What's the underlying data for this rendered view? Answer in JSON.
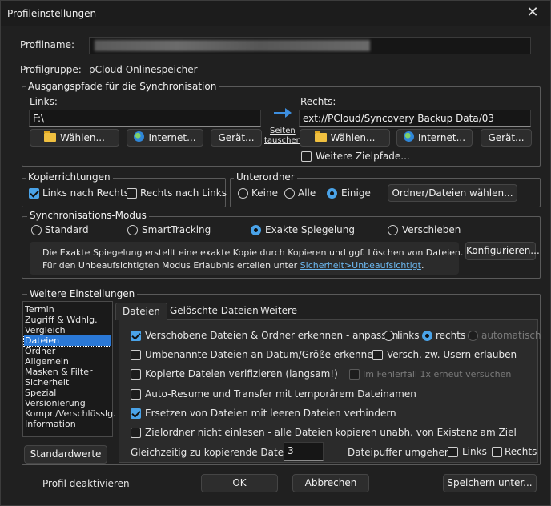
{
  "window": {
    "title": "Profileinstellungen",
    "close": "✕"
  },
  "profile": {
    "name_label": "Profilname:",
    "group_label": "Profilgruppe:",
    "group_value": "pCloud Onlinespeicher"
  },
  "paths": {
    "title": "Ausgangspfade für die Synchronisation",
    "left_label": "Links:",
    "left_value": "F:\\",
    "right_label": "Rechts:",
    "right_value": "ext://PCloud/Syncovery Backup Data/03",
    "swap_line1": "Seiten",
    "swap_line2": "tauschen",
    "choose": "Wählen...",
    "internet": "Internet...",
    "device": "Gerät...",
    "more_targets": "Weitere Zielpfade...",
    "more_targets_checked": false
  },
  "copy_directions": {
    "title": "Kopierrichtungen",
    "left_to_right": "Links nach Rechts",
    "left_to_right_checked": true,
    "right_to_left": "Rechts nach Links",
    "right_to_left_checked": false
  },
  "subfolders": {
    "title": "Unterordner",
    "options": [
      "Keine",
      "Alle",
      "Einige"
    ],
    "selected": "Einige",
    "choose_button": "Ordner/Dateien wählen..."
  },
  "sync_mode": {
    "title": "Synchronisations-Modus",
    "options": [
      "Standard",
      "SmartTracking",
      "Exakte Spiegelung",
      "Verschieben"
    ],
    "selected": "Exakte Spiegelung",
    "info_line1": "Die Exakte Spiegelung erstellt eine exakte Kopie durch Kopieren und ggf. Löschen von Dateien.",
    "info_line2": "Für den Unbeaufsichtigten Modus Erlaubnis erteilen unter",
    "info_link": "Sicherheit>Unbeaufsichtigt",
    "info_end": ".",
    "configure": "Konfigurieren..."
  },
  "more_settings": {
    "title": "Weitere Einstellungen",
    "categories": [
      "Termin",
      "Zugriff & Wdhlg.",
      "Vergleich",
      "Dateien",
      "Ordner",
      "Allgemein",
      "Masken & Filter",
      "Sicherheit",
      "Spezial",
      "Versionierung",
      "Kompr./Verschlüsslg.",
      "Information"
    ],
    "selected_category": "Dateien",
    "defaults_button": "Standardwerte",
    "tabs": [
      "Dateien",
      "Gelöschte Dateien",
      "Weitere"
    ],
    "active_tab": "Dateien",
    "opt_moved": "Verschobene Dateien & Ordner erkennen  -  anpassen:",
    "opt_moved_checked": true,
    "adjust_options": [
      "links",
      "rechts",
      "automatisch"
    ],
    "adjust_selected": "rechts",
    "opt_renamed": "Umbenannte Dateien an Datum/Größe erkennen",
    "opt_renamed_checked": false,
    "opt_between_users": "Versch. zw. Usern erlauben",
    "opt_between_users_checked": false,
    "opt_verify": "Kopierte Dateien verifizieren (langsam!)",
    "opt_verify_checked": false,
    "opt_retry": "Im Fehlerfall 1x erneut versuchen",
    "opt_retry_checked": false,
    "opt_autoresume": "Auto-Resume und Transfer mit temporärem Dateinamen",
    "opt_autoresume_checked": false,
    "opt_replace_empty": "Ersetzen von Dateien mit leeren Dateien verhindern",
    "opt_replace_empty_checked": true,
    "opt_no_read_target": "Zielordner nicht einlesen - alle Dateien kopieren unabh. von Existenz am Ziel",
    "opt_no_read_target_checked": false,
    "concurrent_label": "Gleichzeitig zu kopierende Dateien:",
    "concurrent_value": "3",
    "bypass_label": "Dateipuffer umgehen:",
    "bypass_left": "Links",
    "bypass_left_checked": false,
    "bypass_right": "Rechts",
    "bypass_right_checked": false
  },
  "footer": {
    "deactivate": "Profil deaktivieren",
    "ok": "OK",
    "cancel": "Abbrechen",
    "save_as": "Speichern unter..."
  },
  "colors": {
    "accent": "#4aa3e8",
    "selection": "#2a78d6",
    "link": "#6cb8f0",
    "background": "#202020"
  }
}
